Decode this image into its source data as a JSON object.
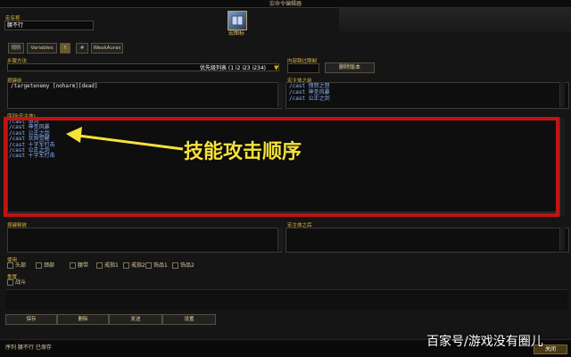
{
  "window": {
    "title": "宏命令编辑器"
  },
  "macro_name": {
    "label": "宏名称",
    "value": "腰不行"
  },
  "icon": {
    "label": "宏图标"
  },
  "tabs": [
    {
      "label": "规则"
    },
    {
      "label": "Variables"
    },
    {
      "label": "!"
    },
    {
      "label": "#"
    },
    {
      "label": "WeakAuras"
    }
  ],
  "sequence": {
    "label": "步骤方法",
    "dropdown_value": "优先级列表 (1 i2 i23 i234)"
  },
  "inner_limit": {
    "label": "内部跳过限制",
    "button_label": "删除版本"
  },
  "keypress": {
    "label": "按键前",
    "text": "/targetenemy [noharm][dead]"
  },
  "macro_body_top": {
    "label": "宏主体之前",
    "lines": [
      "/cast 愤怒之怒",
      "/cast 神圣风暴",
      "/cast 公正之剑"
    ]
  },
  "sequence_body": {
    "label": "序列(宏主体)",
    "lines": [
      "/cast 审判",
      "/cast 神圣风暴",
      "/cast 公正之剑",
      "/cast 灰烬觉醒",
      "/cast 十字军打击",
      "/cast 公正之剑",
      "/cast 十字军打击"
    ]
  },
  "annotation": {
    "text": "技能攻击顺序"
  },
  "key_release": {
    "label": "按键释放"
  },
  "macro_body_after": {
    "label": "宏主体之后"
  },
  "use_checks": {
    "label": "使用",
    "items": [
      "头部",
      "颈部",
      "腰带",
      "戒指1",
      "戒指2",
      "饰品1",
      "饰品2"
    ]
  },
  "reset": {
    "label": "重置",
    "items": [
      "战斗"
    ]
  },
  "buttons": [
    "保存",
    "删除",
    "发送",
    "设置"
  ],
  "status": {
    "text": "序列 腰不行 已保存"
  },
  "watermark": {
    "text": "百家号/游戏没有圈儿"
  },
  "corner_button": {
    "label": "关闭"
  }
}
